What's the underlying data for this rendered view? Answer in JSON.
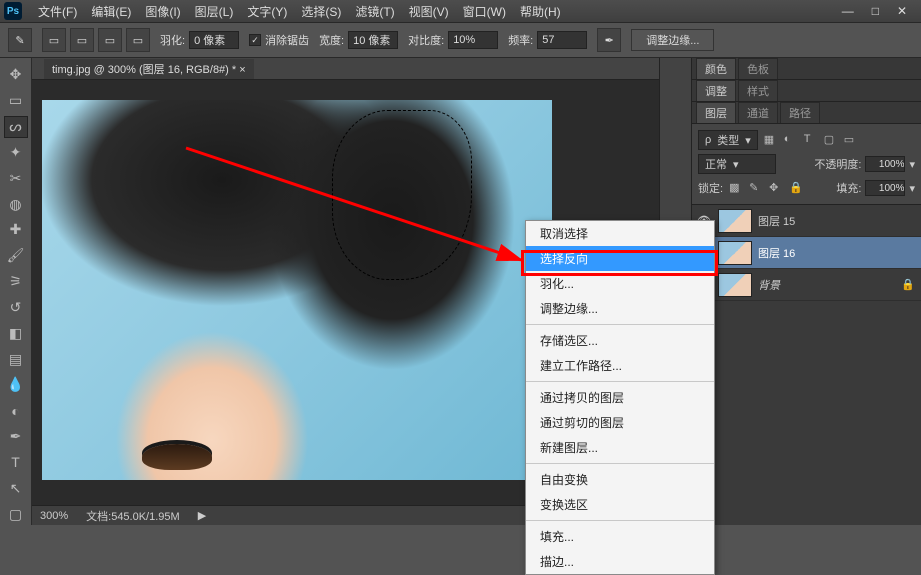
{
  "app": {
    "logo": "Ps"
  },
  "menubar": [
    "文件(F)",
    "编辑(E)",
    "图像(I)",
    "图层(L)",
    "文字(Y)",
    "选择(S)",
    "滤镜(T)",
    "视图(V)",
    "窗口(W)",
    "帮助(H)"
  ],
  "optionsbar": {
    "feather_label": "羽化:",
    "feather_value": "0 像素",
    "antialias_label": "消除锯齿",
    "width_label": "宽度:",
    "width_value": "10 像素",
    "contrast_label": "对比度:",
    "contrast_value": "10%",
    "freq_label": "频率:",
    "freq_value": "57",
    "refine_btn": "调整边缘..."
  },
  "document": {
    "tab": "timg.jpg @ 300% (图层 16, RGB/8#) *",
    "zoom": "300%",
    "status": "文档:545.0K/1.95M"
  },
  "panels": {
    "color_tabs": [
      "颜色",
      "色板"
    ],
    "adjust_tabs": [
      "调整",
      "样式"
    ],
    "layers_tabs": [
      "图层",
      "通道",
      "路径"
    ],
    "layer_type_label": "类型",
    "blend_mode": "正常",
    "opacity_label": "不透明度:",
    "opacity_value": "100%",
    "lock_label": "锁定:",
    "fill_label": "填充:",
    "fill_value": "100%",
    "layers": [
      {
        "name": "图层 15",
        "selected": false,
        "locked": false,
        "italic": false
      },
      {
        "name": "图层 16",
        "selected": true,
        "locked": false,
        "italic": false
      },
      {
        "name": "背景",
        "selected": false,
        "locked": true,
        "italic": true
      }
    ]
  },
  "context_menu": {
    "items": [
      {
        "label": "取消选择",
        "type": "item"
      },
      {
        "label": "选择反向",
        "type": "item",
        "highlight": true
      },
      {
        "label": "羽化...",
        "type": "item"
      },
      {
        "label": "调整边缘...",
        "type": "item"
      },
      {
        "type": "sep"
      },
      {
        "label": "存储选区...",
        "type": "item"
      },
      {
        "label": "建立工作路径...",
        "type": "item"
      },
      {
        "type": "sep"
      },
      {
        "label": "通过拷贝的图层",
        "type": "item"
      },
      {
        "label": "通过剪切的图层",
        "type": "item"
      },
      {
        "label": "新建图层...",
        "type": "item"
      },
      {
        "type": "sep"
      },
      {
        "label": "自由变换",
        "type": "item"
      },
      {
        "label": "变换选区",
        "type": "item"
      },
      {
        "type": "sep"
      },
      {
        "label": "填充...",
        "type": "item"
      },
      {
        "label": "描边...",
        "type": "item"
      }
    ]
  }
}
